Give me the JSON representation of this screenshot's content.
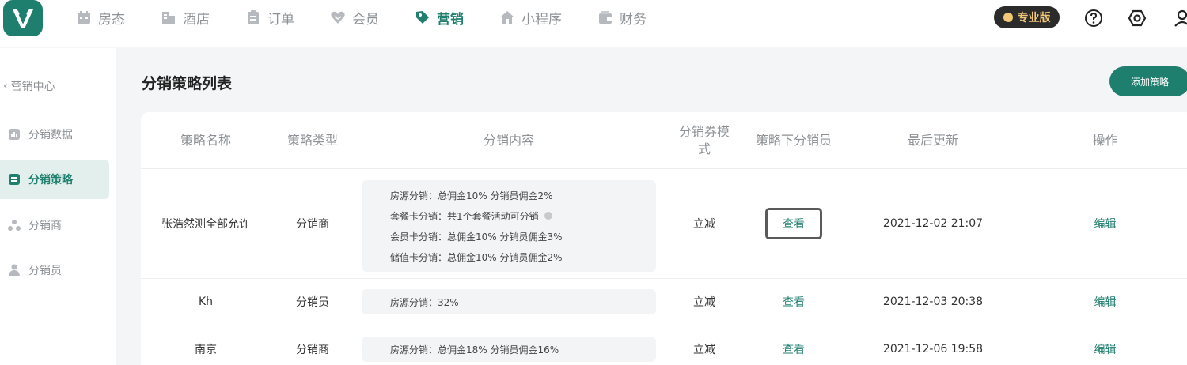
{
  "nav": {
    "items": [
      {
        "label": "房态",
        "icon": "calendar-icon",
        "active": false
      },
      {
        "label": "酒店",
        "icon": "building-icon",
        "active": false
      },
      {
        "label": "订单",
        "icon": "clipboard-icon",
        "active": false
      },
      {
        "label": "会员",
        "icon": "member-heart-icon",
        "active": false
      },
      {
        "label": "营销",
        "icon": "tag-icon",
        "active": true
      },
      {
        "label": "小程序",
        "icon": "home-icon",
        "active": false
      },
      {
        "label": "财务",
        "icon": "wallet-icon",
        "active": false
      }
    ],
    "pro_badge": "专业版"
  },
  "sidebar": {
    "back_label": "营销中心",
    "items": [
      {
        "label": "分销数据",
        "icon": "bar-chart-icon",
        "active": false
      },
      {
        "label": "分销策略",
        "icon": "list-icon",
        "active": true
      },
      {
        "label": "分销商",
        "icon": "org-icon",
        "active": false
      },
      {
        "label": "分销员",
        "icon": "person-icon",
        "active": false
      }
    ]
  },
  "main": {
    "title": "分销策略列表",
    "add_button": "添加策略",
    "table": {
      "headers": [
        "策略名称",
        "策略类型",
        "分销内容",
        "分销券模式",
        "策略下分销员",
        "最后更新",
        "操作"
      ],
      "rows": [
        {
          "name": "张浩然测全部允许",
          "type": "分销商",
          "content": [
            "房源分销：总佣金10%  分销员佣金2%",
            "套餐卡分销：共1个套餐活动可分销",
            "会员卡分销：总佣金10%  分销员佣金3%",
            "储值卡分销：总佣金10%  分销员佣金2%"
          ],
          "mode": "立减",
          "view": "查看",
          "updated": "2021-12-02 21:07",
          "action": "编辑"
        },
        {
          "name": "Kh",
          "type": "分销员",
          "content": [
            "房源分销：32%"
          ],
          "mode": "立减",
          "view": "查看",
          "updated": "2021-12-03 20:38",
          "action": "编辑"
        },
        {
          "name": "南京",
          "type": "分销商",
          "content": [
            "房源分销：总佣金18%  分销员佣金16%"
          ],
          "mode": "立减",
          "view": "查看",
          "updated": "2021-12-06 19:58",
          "action": "编辑"
        }
      ]
    }
  },
  "colors": {
    "accent": "#1f7f6e",
    "muted": "#8e9296",
    "pro_gold": "#f2c877"
  }
}
